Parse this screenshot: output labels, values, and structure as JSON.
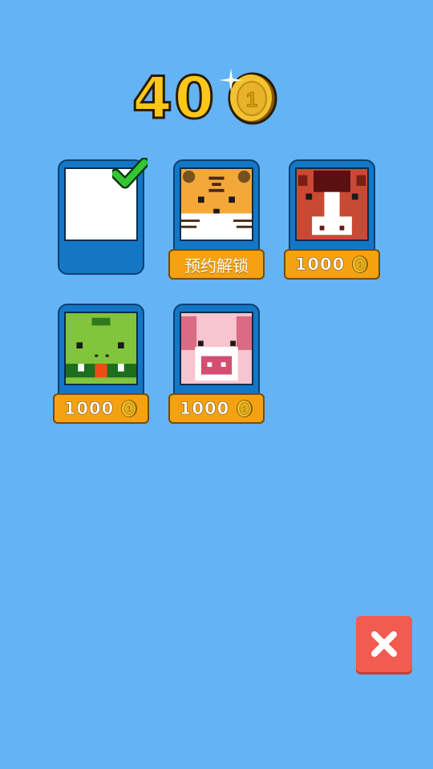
{
  "header": {
    "coin_count": "40"
  },
  "skins": [
    {
      "id": "blank",
      "state": "selected"
    },
    {
      "id": "tiger",
      "label": "预约解锁"
    },
    {
      "id": "bull",
      "price": "1000"
    },
    {
      "id": "crocodile",
      "price": "1000"
    },
    {
      "id": "pig",
      "price": "1000"
    }
  ],
  "icons": {
    "coin": "coin-icon",
    "check": "check-icon",
    "close": "close-icon"
  }
}
